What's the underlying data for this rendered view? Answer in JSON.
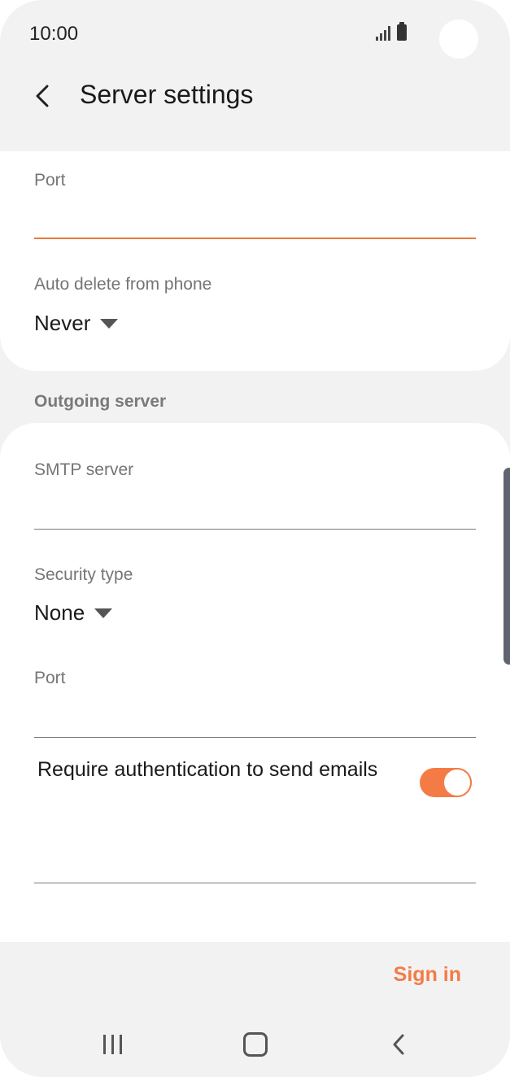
{
  "status_bar": {
    "time": "10:00"
  },
  "header": {
    "title": "Server settings",
    "back_icon": "chevron-left-icon"
  },
  "incoming": {
    "port_label": "Port",
    "port_value": "",
    "auto_delete_label": "Auto delete from phone",
    "auto_delete_value": "Never"
  },
  "outgoing": {
    "section_title": "Outgoing server",
    "smtp_label": "SMTP server",
    "smtp_value": "",
    "security_label": "Security type",
    "security_value": "None",
    "port_label": "Port",
    "port_value": "",
    "require_auth_label": "Require authentication to send emails",
    "require_auth_enabled": true
  },
  "footer": {
    "sign_in_label": "Sign in"
  },
  "nav_bar": {
    "recents_icon": "recents-icon",
    "home_icon": "home-icon",
    "back_icon": "back-icon"
  },
  "colors": {
    "accent": "#f47b46",
    "background": "#f2f2f2",
    "card": "#ffffff"
  }
}
